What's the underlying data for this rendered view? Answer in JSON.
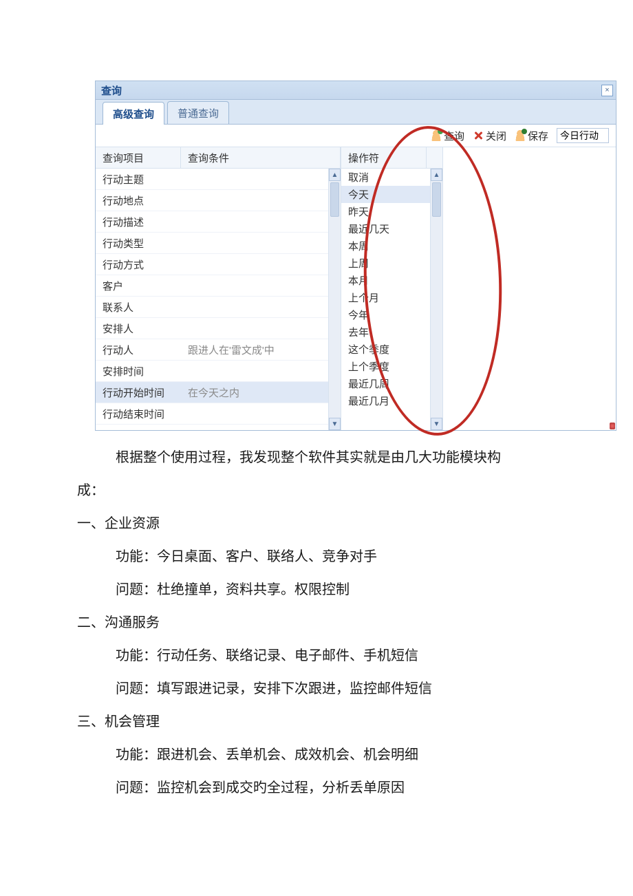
{
  "window": {
    "title": "查询",
    "close_tip": "×",
    "tabs": [
      {
        "label": "高级查询",
        "active": true
      },
      {
        "label": "普通查询",
        "active": false
      }
    ],
    "toolbar": {
      "query": "查询",
      "close": "关闭",
      "save": "保存",
      "save_name_value": "今日行动"
    },
    "left_headers": {
      "col1": "查询项目",
      "col2": "查询条件"
    },
    "mid_header": "操作符",
    "query_items": [
      {
        "label": "行动主题",
        "cond": ""
      },
      {
        "label": "行动地点",
        "cond": ""
      },
      {
        "label": "行动描述",
        "cond": ""
      },
      {
        "label": "行动类型",
        "cond": ""
      },
      {
        "label": "行动方式",
        "cond": ""
      },
      {
        "label": "客户",
        "cond": ""
      },
      {
        "label": "联系人",
        "cond": ""
      },
      {
        "label": "安排人",
        "cond": ""
      },
      {
        "label": "行动人",
        "cond": "跟进人在'雷文成'中"
      },
      {
        "label": "安排时间",
        "cond": ""
      },
      {
        "label": "行动开始时间",
        "cond": "在今天之内",
        "selected": true
      },
      {
        "label": "行动结束时间",
        "cond": ""
      }
    ],
    "operators": [
      {
        "label": "取消"
      },
      {
        "label": "今天",
        "highlight": true
      },
      {
        "label": "昨天"
      },
      {
        "label": "最近几天"
      },
      {
        "label": "本周"
      },
      {
        "label": "上周"
      },
      {
        "label": "本月"
      },
      {
        "label": "上个月"
      },
      {
        "label": "今年"
      },
      {
        "label": "去年"
      },
      {
        "label": "这个季度"
      },
      {
        "label": "上个季度"
      },
      {
        "label": "最近几周"
      },
      {
        "label": "最近几月"
      }
    ]
  },
  "document": {
    "para_intro_line1": "根据整个使用过程，我发现整个软件其实就是由几大功能模块构",
    "para_intro_line2": "成：",
    "sec1_title": "一、企业资源",
    "sec1_func": "功能：今日桌面、客户、联络人、竞争对手",
    "sec1_prob": "问题：杜绝撞单，资料共享。权限控制",
    "sec2_title": "二、沟通服务",
    "sec2_func": "功能：行动任务、联络记录、电子邮件、手机短信",
    "sec2_prob": "问题：填写跟进记录，安排下次跟进，监控邮件短信",
    "sec3_title": "三、机会管理",
    "sec3_func": "功能：跟进机会、丢单机会、成效机会、机会明细",
    "sec3_prob": "问题：监控机会到成交旳全过程，分析丢单原因"
  }
}
